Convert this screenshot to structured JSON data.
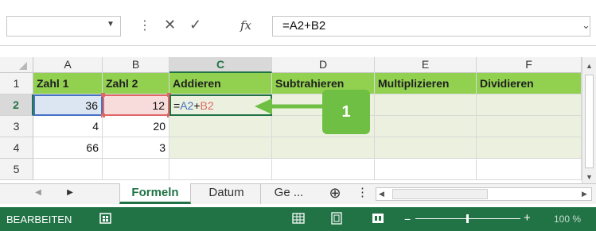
{
  "formula_bar": {
    "formula": "=A2+B2",
    "fx_label": "fx",
    "cancel_glyph": "✕",
    "enter_glyph": "✓",
    "separator_glyph": "⋮",
    "dropdown_glyph": "▼",
    "expand_glyph": "⌄"
  },
  "columns": [
    "A",
    "B",
    "C",
    "D",
    "E",
    "F"
  ],
  "rows": [
    "1",
    "2",
    "3",
    "4",
    "5"
  ],
  "cells": {
    "A1": "Zahl 1",
    "B1": "Zahl 2",
    "C1": "Addieren",
    "D1": "Subtrahieren",
    "E1": "Multiplizieren",
    "F1": "Dividieren",
    "A2": "36",
    "B2": "12",
    "A3": "4",
    "B3": "20",
    "A4": "66",
    "B4": "3",
    "C2_parts": [
      "=",
      "A2",
      "+",
      "B2"
    ]
  },
  "callout": {
    "label": "1"
  },
  "sheet_tabs": {
    "active": "Formeln",
    "tabs": [
      "Formeln",
      "Datum",
      "Ge ..."
    ],
    "add_glyph": "⊕",
    "more_glyph": "⋮",
    "nav_left": "◀",
    "nav_right": "▶"
  },
  "status_bar": {
    "mode": "BEARBEITEN",
    "zoom": "100 %"
  },
  "colors": {
    "header_fill": "#92d050",
    "body_fill": "#ebf1de",
    "ref_a2": "#4472c4",
    "ref_b2": "#e06666",
    "callout_fill": "#6fbf44",
    "status_bar": "#217346"
  }
}
